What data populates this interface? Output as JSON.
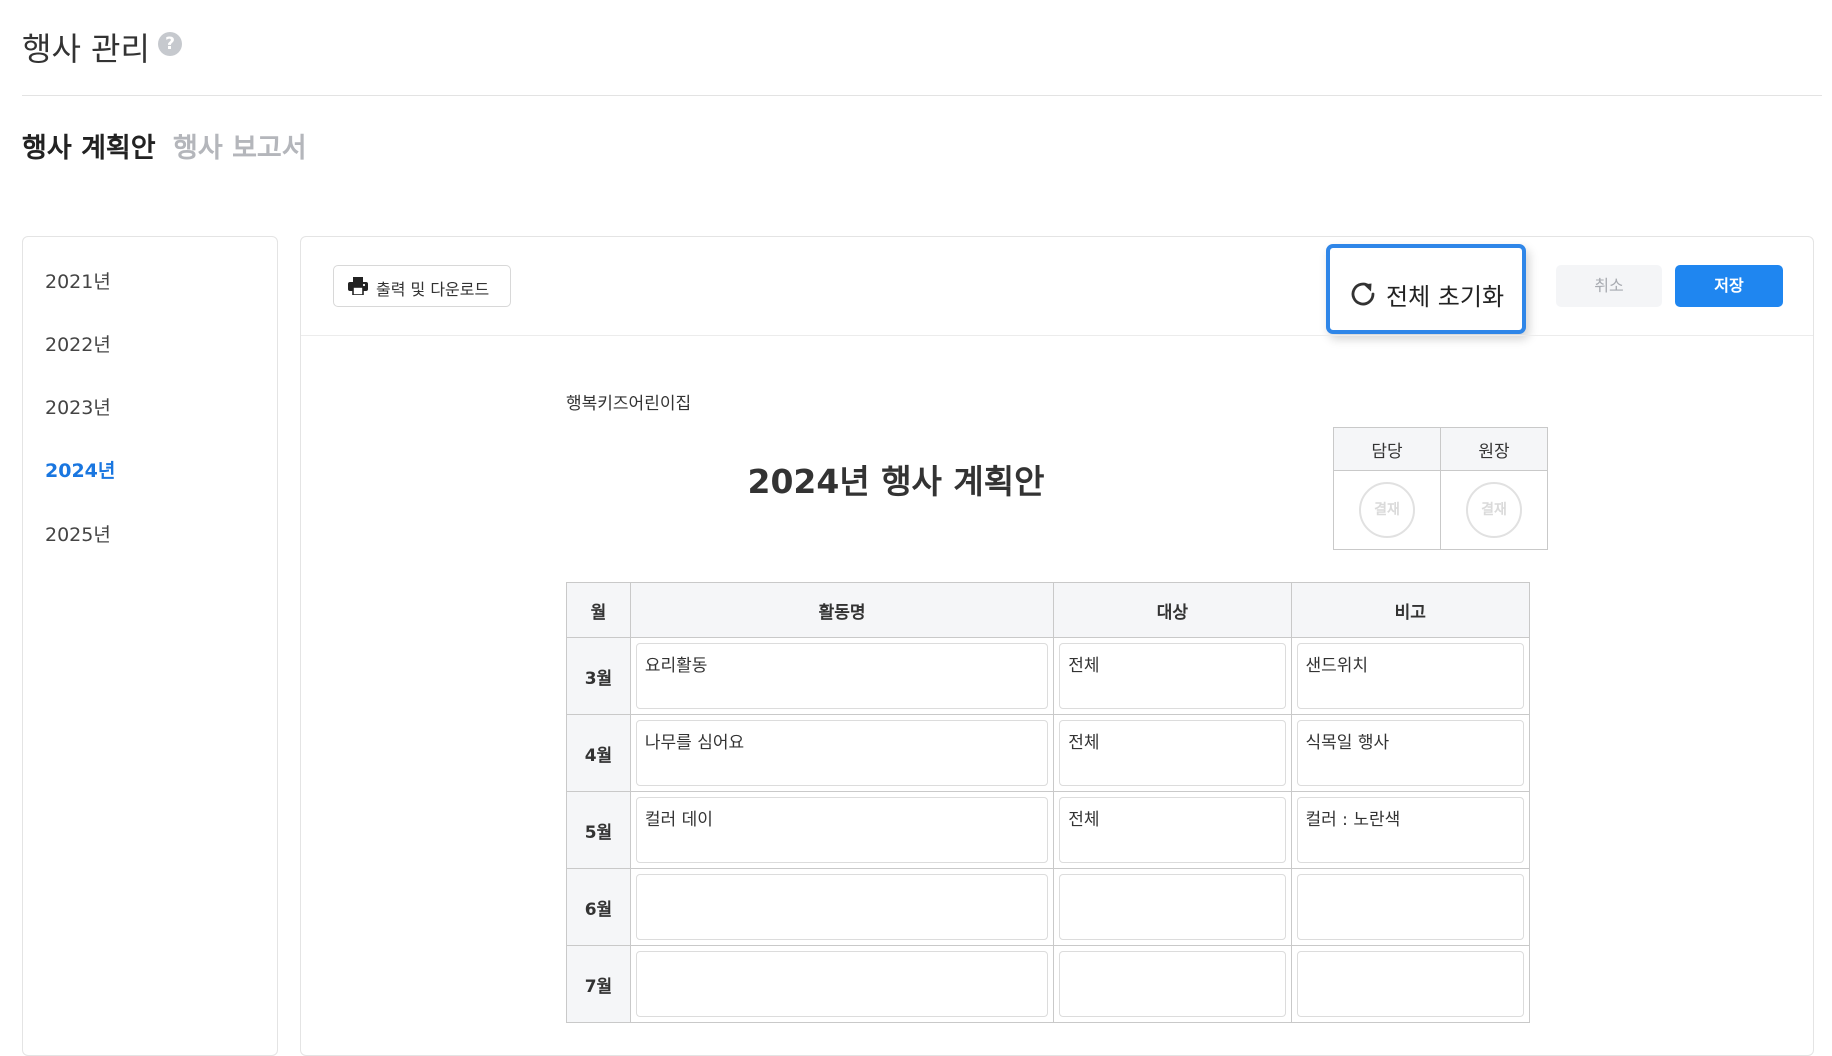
{
  "header": {
    "title": "행사 관리",
    "help_icon": "question-circle-icon"
  },
  "tabs": [
    {
      "label": "행사 계획안",
      "active": true
    },
    {
      "label": "행사 보고서",
      "active": false
    }
  ],
  "years": [
    {
      "label": "2021년",
      "selected": false
    },
    {
      "label": "2022년",
      "selected": false
    },
    {
      "label": "2023년",
      "selected": false
    },
    {
      "label": "2024년",
      "selected": true
    },
    {
      "label": "2025년",
      "selected": false
    }
  ],
  "toolbar": {
    "print_label": "출력 및 다운로드",
    "reset_label": "전체 초기화",
    "cancel_label": "취소",
    "save_label": "저장"
  },
  "document": {
    "org_name": "행복키즈어린이집",
    "title": "2024년 행사 계획안",
    "approval": {
      "headers": [
        "담당",
        "원장"
      ],
      "stamp_text": "결재"
    },
    "table": {
      "headers": [
        "월",
        "활동명",
        "대상",
        "비고"
      ],
      "rows": [
        {
          "month": "3월",
          "activity": "요리활동",
          "target": "전체",
          "note": "샌드위치"
        },
        {
          "month": "4월",
          "activity": "나무를 심어요",
          "target": "전체",
          "note": "식목일 행사"
        },
        {
          "month": "5월",
          "activity": "컬러 데이",
          "target": "전체",
          "note": "컬러 : 노란색"
        },
        {
          "month": "6월",
          "activity": "",
          "target": "",
          "note": ""
        },
        {
          "month": "7월",
          "activity": "",
          "target": "",
          "note": ""
        }
      ]
    }
  },
  "colors": {
    "accent": "#1f86f0",
    "selected_year": "#1976e0",
    "highlight_border": "#2f86e8"
  }
}
